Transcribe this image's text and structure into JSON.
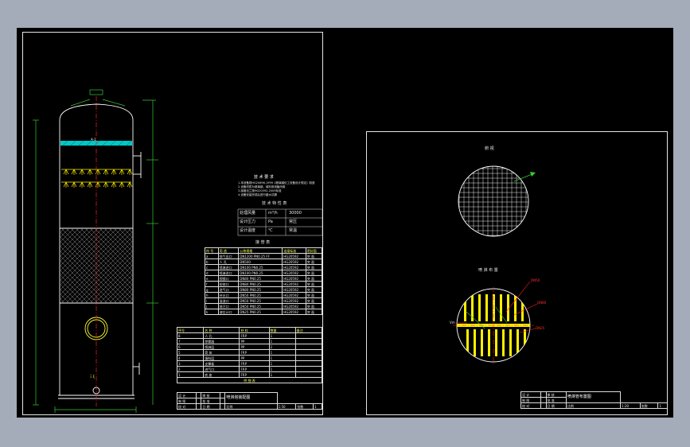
{
  "viewport": {
    "background": "#a3acb8",
    "canvas_background": "#000000"
  },
  "colors": {
    "frame": "#e6e6e6",
    "dimension": "#33cc33",
    "centerline": "#ff2020",
    "annotation": "#ffff33",
    "pipe": "#ffee00",
    "fill": "#00d0d0"
  },
  "left_sheet": {
    "vessel_top_label": "A-1",
    "sample_label": "Ξ ξ",
    "notes": {
      "title": "技 术 要 求",
      "lines": [
        "1.本设备按HG20696-1999《玻璃钢化工设备设计规定》制造",
        "2.设备材质为玻璃钢，填料采用聚丙烯",
        "3.接管法兰按HG20592-2009标准",
        "4.设备安装完成后进行盛水试漏"
      ]
    },
    "spec_table": {
      "title": "技 术 特 性 表",
      "rows": [
        [
          "处理风量",
          "m³/h",
          "30000"
        ],
        [
          "设计压力",
          "Pa",
          "常压"
        ],
        [
          "设计温度",
          "℃",
          "常温"
        ]
      ]
    },
    "nozzle_table": {
      "title": "接 管 表",
      "header": [
        "符 号",
        "用 途",
        "公称规格",
        "连接标准",
        "密封面"
      ],
      "rows": [
        [
          "a",
          "排气出口",
          "DN1200 PN0.25 FF",
          "HG20592",
          "突 面"
        ],
        [
          "b",
          "人 孔",
          "DN500",
          "HG20592",
          "突 面"
        ],
        [
          "c",
          "喷淋进口",
          "DN100 PN0.25",
          "HG20592",
          "突 面"
        ],
        [
          "d",
          "喷淋进口",
          "DN100 PN0.25",
          "HG20592",
          "突 面"
        ],
        [
          "e",
          "视镜口",
          "DN80 PN0.25",
          "HG20592",
          "突 面"
        ],
        [
          "f",
          "检修口",
          "DN80 PN0.25",
          "HG20592",
          "突 面"
        ],
        [
          "g",
          "进气口",
          "DN80 PN0.25",
          "HG20592",
          "突 面"
        ],
        [
          "h",
          "补水口",
          "DN50 PN0.25",
          "HG20592",
          "突 面"
        ],
        [
          "i",
          "溢流口",
          "DN50 PN0.25",
          "HG20592",
          "突 面"
        ],
        [
          "j",
          "排污口",
          "DN50 PN0.25",
          "HG20592",
          "突 面"
        ],
        [
          "k",
          "液位计口",
          "DN25 PN0.25",
          "HG20592",
          "突 面"
        ]
      ]
    },
    "bom_table": {
      "header": [
        "序号",
        "名 称",
        "材 料",
        "数量",
        "备注"
      ],
      "rows": [
        [
          "8",
          "人 孔",
          "FRP",
          "1",
          ""
        ],
        [
          "7",
          "除雾器",
          "PP",
          "1",
          ""
        ],
        [
          "6",
          "喷淋层",
          "PP",
          "2",
          ""
        ],
        [
          "5",
          "筒 体",
          "FRP",
          "1",
          ""
        ],
        [
          "4",
          "填料层",
          "PP",
          "1",
          ""
        ],
        [
          "3",
          "支撑板",
          "FRP",
          "1",
          ""
        ],
        [
          "2",
          "进气口",
          "FRP",
          "1",
          ""
        ],
        [
          "1",
          "底 座",
          "FRP",
          "1",
          ""
        ]
      ],
      "footer": "明 细 表"
    },
    "title_block": {
      "drawing_title": "喷淋塔装配图",
      "rows": [
        [
          "设 计",
          "",
          "审 核",
          ""
        ],
        [
          "制 图",
          "",
          "批 准",
          ""
        ],
        [
          "校 对",
          "",
          "日 期",
          ""
        ]
      ],
      "scale_row": [
        "比例",
        "1:50",
        "张数",
        "1"
      ]
    }
  },
  "right_sheet": {
    "top_view_label": "俯 视",
    "section_label": "喷 淋 布 置",
    "callouts": [
      "DN50",
      "DN80",
      "DN25"
    ],
    "side_label": "Vm",
    "title_block": {
      "drawing_title": "喷淋管布置图",
      "rows": [
        [
          "设 计",
          "",
          "审 核"
        ],
        [
          "制 图",
          "",
          "批 准"
        ],
        [
          "校 对",
          "",
          "日 期"
        ]
      ],
      "scale_row": [
        "比例",
        "1:20",
        "张数",
        "1"
      ]
    }
  }
}
